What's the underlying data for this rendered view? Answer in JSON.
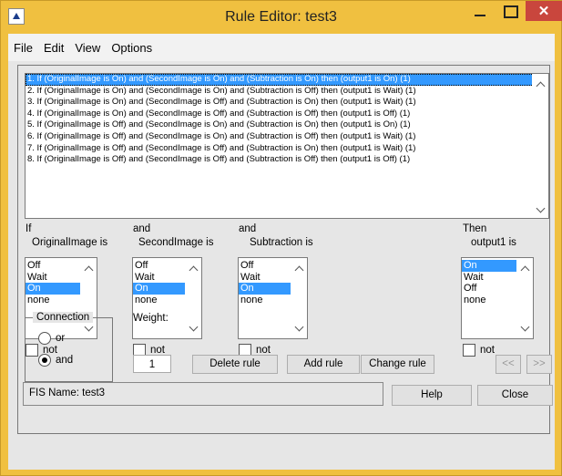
{
  "window": {
    "title": "Rule Editor: test3",
    "close_glyph": "✕"
  },
  "menu": [
    "File",
    "Edit",
    "View",
    "Options"
  ],
  "rules": [
    "1. If (OriginalImage is On) and (SecondImage is On) and (Subtraction is On) then (output1 is On) (1)",
    "2. If (OriginalImage is On) and (SecondImage is On) and (Subtraction is Off) then (output1 is Wait) (1)",
    "3. If (OriginalImage is On) and (SecondImage is Off) and (Subtraction is On) then (output1 is Wait) (1)",
    "4. If (OriginalImage is On) and (SecondImage is Off) and (Subtraction is Off) then (output1 is Off) (1)",
    "5. If (OriginalImage is Off) and (SecondImage is On) and (Subtraction is On) then (output1 is On) (1)",
    "6. If (OriginalImage is Off) and (SecondImage is On) and (Subtraction is Off) then (output1 is Wait) (1)",
    "7. If (OriginalImage is Off) and (SecondImage is Off) and (Subtraction is On) then (output1 is Wait) (1)",
    "8. If (OriginalImage is Off) and (SecondImage is Off) and (Subtraction is Off) then (output1 is Off) (1)"
  ],
  "selected_rule": 0,
  "columns": [
    {
      "prefix": "If",
      "label": "OriginalImage is",
      "options": [
        "Off",
        "Wait",
        "On",
        "none"
      ],
      "selected": 2,
      "not_label": "not"
    },
    {
      "prefix": "and",
      "label": "SecondImage is",
      "options": [
        "Off",
        "Wait",
        "On",
        "none"
      ],
      "selected": 2,
      "not_label": "not"
    },
    {
      "prefix": "and",
      "label": "Subtraction is",
      "options": [
        "Off",
        "Wait",
        "On",
        "none"
      ],
      "selected": 2,
      "not_label": "not"
    },
    {
      "prefix": "Then",
      "label": "output1 is",
      "options": [
        "On",
        "Wait",
        "Off",
        "none"
      ],
      "selected": 0,
      "not_label": "not"
    }
  ],
  "connection": {
    "title": "Connection",
    "or_label": "or",
    "and_label": "and",
    "selected": "and"
  },
  "weight": {
    "label": "Weight:",
    "value": "1"
  },
  "buttons": {
    "delete": "Delete rule",
    "add": "Add rule",
    "change": "Change rule",
    "prev": "<<",
    "next": ">>",
    "help": "Help",
    "close": "Close"
  },
  "status": "FIS Name: test3"
}
